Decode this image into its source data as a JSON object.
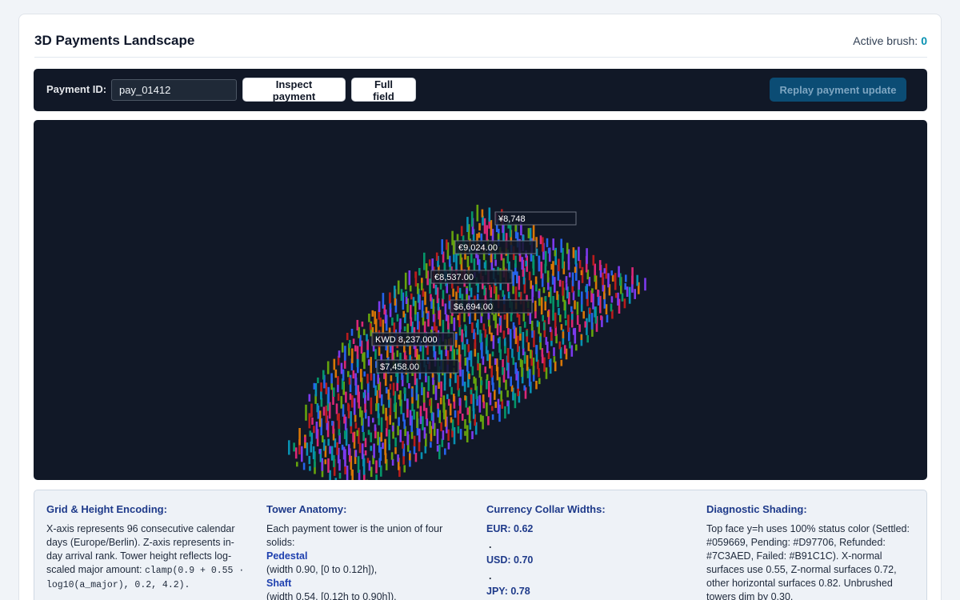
{
  "header": {
    "title": "3D Payments Landscape",
    "active_brush_label": "Active brush:",
    "active_brush_count": "0"
  },
  "toolbar": {
    "payment_id_label": "Payment ID:",
    "payment_id_value": "pay_01412",
    "inspect_label": "Inspect payment",
    "full_field_label": "Full field",
    "replay_label": "Replay payment update"
  },
  "viewport": {
    "labels": [
      "¥8,748",
      "€9,024.00",
      "€8,537.00",
      "$6,694.00",
      "KWD 8,237.000",
      "$7,458.00"
    ],
    "status_colors": [
      "#059669",
      "#D97706",
      "#7C3AED",
      "#B91C1C"
    ]
  },
  "legend": {
    "grid": {
      "title": "Grid & Height Encoding:",
      "text": "X-axis represents 96 consecutive calendar days (Europe/Berlin). Z-axis represents in-day arrival rank. Tower height reflects log-scaled major amount:",
      "code": "clamp(0.9 + 0.55 · log10(a_major), 0.2, 4.2)."
    },
    "tower": {
      "title": "Tower Anatomy:",
      "intro": "Each payment tower is the union of four solids:",
      "pedestal_title": "Pedestal",
      "pedestal_text": "(width 0.90, [0 to 0.12h]),",
      "shaft_title": "Shaft",
      "shaft_text": "(width 0.54, [0.12h to 0.90h]),"
    },
    "currency": {
      "title": "Currency Collar Widths:",
      "eur": "EUR: 0.62",
      "usd": "USD: 0.70",
      "jpy": "JPY: 0.78",
      "dot": "."
    },
    "shading": {
      "title": "Diagnostic Shading:",
      "text": "Top face y=h uses 100% status color (Settled: #059669, Pending: #D97706, Refunded: #7C3AED, Failed: #B91C1C). X-normal surfaces use 0.55, Z-normal surfaces 0.72, other horizontal surfaces 0.82. Unbrushed towers dim by 0.30."
    }
  }
}
